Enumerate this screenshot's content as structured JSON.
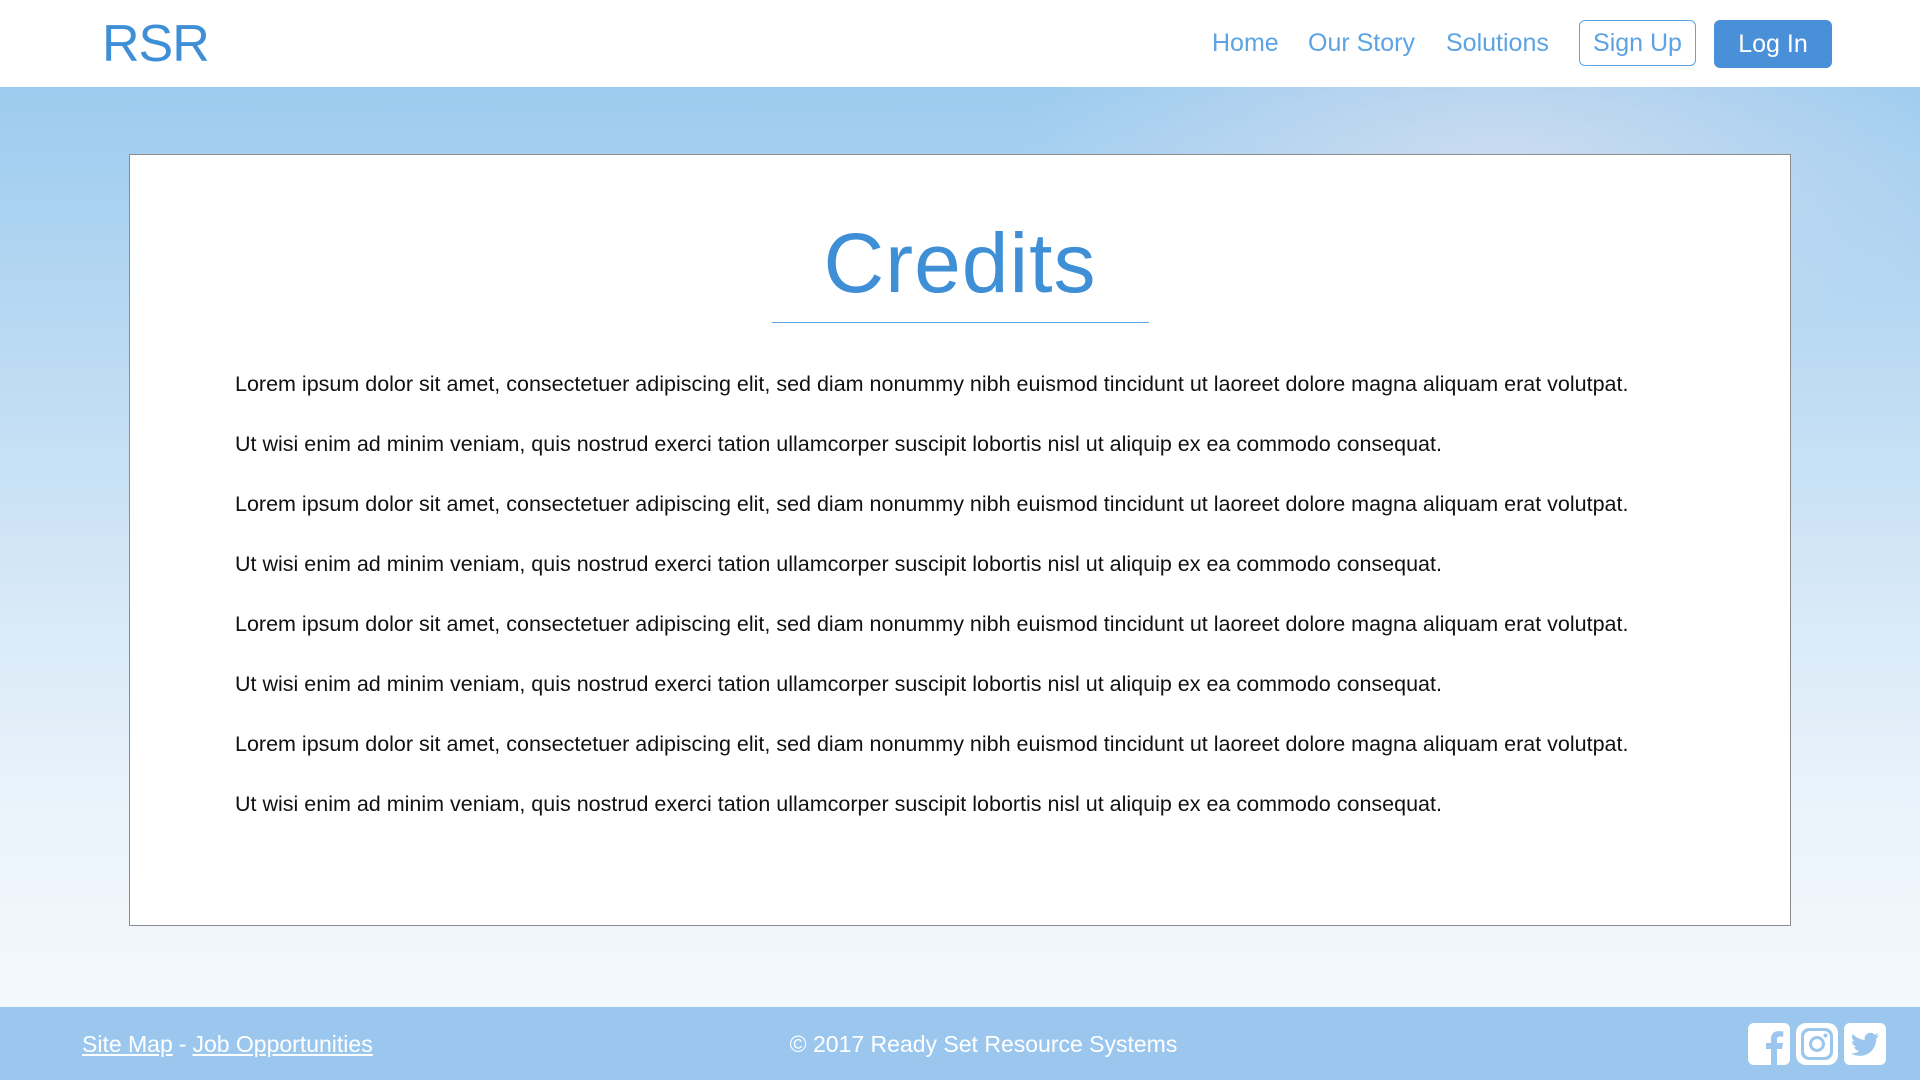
{
  "header": {
    "logo": "RSR",
    "nav": {
      "home": "Home",
      "our_story": "Our Story",
      "solutions": "Solutions"
    },
    "sign_up": "Sign Up",
    "log_in": "Log In"
  },
  "colors": {
    "brand_blue": "#3f8fd6",
    "link_blue": "#5ca3e3",
    "button_blue": "#4a90d9",
    "footer_blue": "#9bc7ee"
  },
  "main": {
    "title": "Credits",
    "paragraphs": [
      "Lorem ipsum dolor sit amet, consectetuer adipiscing elit, sed diam nonummy nibh euismod tincidunt ut laoreet dolore magna aliquam erat volutpat.",
      "Ut wisi enim ad minim veniam, quis nostrud exerci tation ullamcorper suscipit lobortis nisl ut aliquip ex ea commodo consequat.",
      "Lorem ipsum dolor sit amet, consectetuer adipiscing elit, sed diam nonummy nibh euismod tincidunt ut laoreet dolore magna aliquam erat volutpat.",
      "Ut wisi enim ad minim veniam, quis nostrud exerci tation ullamcorper suscipit lobortis nisl ut aliquip ex ea commodo consequat.",
      "Lorem ipsum dolor sit amet, consectetuer adipiscing elit, sed diam nonummy nibh euismod tincidunt ut laoreet dolore magna aliquam erat volutpat.",
      "Ut wisi enim ad minim veniam, quis nostrud exerci tation ullamcorper suscipit lobortis nisl ut aliquip ex ea commodo consequat.",
      "Lorem ipsum dolor sit amet, consectetuer adipiscing elit, sed diam nonummy nibh euismod tincidunt ut laoreet dolore magna aliquam erat volutpat.",
      "Ut wisi enim ad minim veniam, quis nostrud exerci tation ullamcorper suscipit lobortis nisl ut aliquip ex ea commodo consequat."
    ]
  },
  "footer": {
    "site_map": "Site Map",
    "separator": "-",
    "job_opportunities": "Job Opportunities",
    "copyright": "© 2017 Ready Set Resource Systems",
    "social_icons": [
      "facebook-icon",
      "instagram-icon",
      "twitter-icon"
    ]
  }
}
